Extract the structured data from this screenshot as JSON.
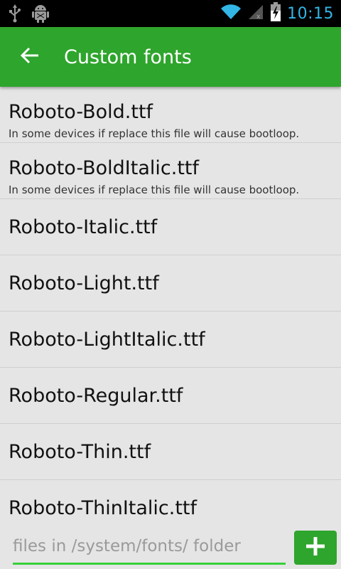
{
  "status_bar": {
    "time": "10:15",
    "icons": [
      "usb-icon",
      "android-debug-icon",
      "wifi-icon",
      "signal-icon",
      "battery-charging-icon"
    ],
    "accent_color": "#33b5e5"
  },
  "toolbar": {
    "title": "Custom fonts",
    "back_icon": "arrow-left-icon",
    "background_color": "#2ea52c"
  },
  "fonts": [
    {
      "name": "Roboto-Bold.ttf",
      "note": "In some devices if replace this file will cause bootloop."
    },
    {
      "name": "Roboto-BoldItalic.ttf",
      "note": "In some devices if replace this file will cause bootloop."
    },
    {
      "name": "Roboto-Italic.ttf"
    },
    {
      "name": "Roboto-Light.ttf"
    },
    {
      "name": "Roboto-LightItalic.ttf"
    },
    {
      "name": "Roboto-Regular.ttf"
    },
    {
      "name": "Roboto-Thin.ttf"
    },
    {
      "name": "Roboto-ThinItalic.ttf"
    }
  ],
  "bottom_bar": {
    "path_placeholder": "files in /system/fonts/ folder",
    "add_icon": "plus-icon"
  }
}
